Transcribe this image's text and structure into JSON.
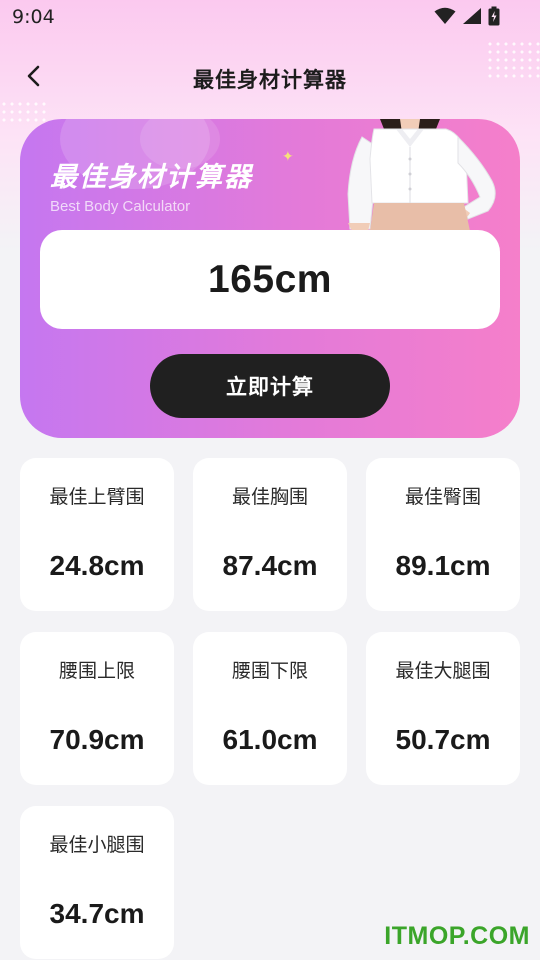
{
  "status_bar": {
    "time": "9:04",
    "icons": [
      "wifi-icon",
      "signal-icon",
      "battery-icon"
    ]
  },
  "header": {
    "back_icon": "chevron-left-icon",
    "title": "最佳身材计算器"
  },
  "hero": {
    "title": "最佳身材计算器",
    "subtitle": "Best Body Calculator",
    "height_value": "165cm",
    "calculate_button": "立即计算"
  },
  "results": [
    {
      "label": "最佳上臂围",
      "value": "24.8cm"
    },
    {
      "label": "最佳胸围",
      "value": "87.4cm"
    },
    {
      "label": "最佳臀围",
      "value": "89.1cm"
    },
    {
      "label": "腰围上限",
      "value": "70.9cm"
    },
    {
      "label": "腰围下限",
      "value": "61.0cm"
    },
    {
      "label": "最佳大腿围",
      "value": "50.7cm"
    },
    {
      "label": "最佳小腿围",
      "value": "34.7cm"
    }
  ],
  "watermark": "ITMOP.COM",
  "colors": {
    "accent_gradient_start": "#c577f0",
    "accent_gradient_end": "#f57fca",
    "button_bg": "#202020",
    "watermark": "#3ba52a"
  }
}
